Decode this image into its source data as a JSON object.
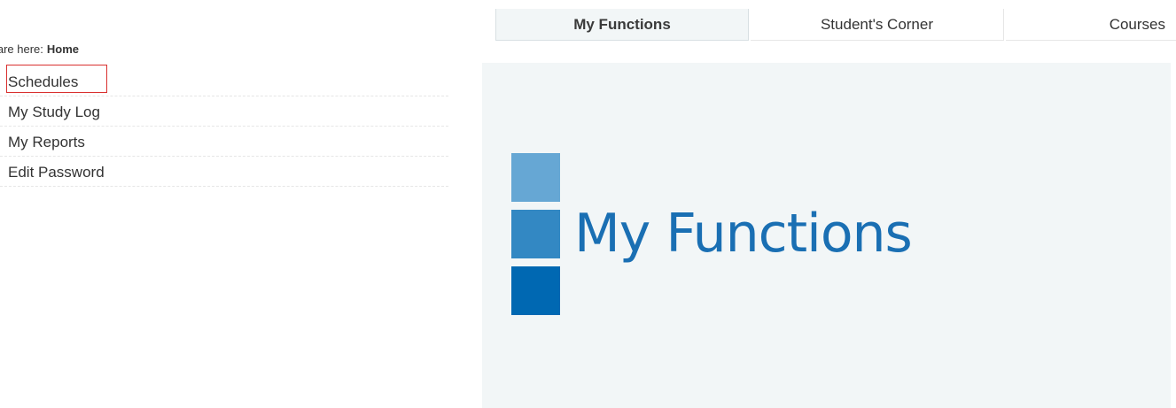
{
  "breadcrumb": {
    "prefix": "u are here:",
    "current": "Home"
  },
  "sidebar": {
    "items": [
      {
        "label": "Schedules"
      },
      {
        "label": "My Study Log"
      },
      {
        "label": "My Reports"
      },
      {
        "label": "Edit Password"
      }
    ]
  },
  "tabs": [
    {
      "label": "My Functions"
    },
    {
      "label": "Student's Corner"
    },
    {
      "label": "Courses"
    }
  ],
  "hero": {
    "title": "My Functions"
  },
  "colors": {
    "panel_bg": "#f2f6f7",
    "accent": "#1a6fb3",
    "block_light": "#66a7d4",
    "block_mid": "#3388c3",
    "block_dark": "#0068b2",
    "focus_border": "#d9302f"
  }
}
